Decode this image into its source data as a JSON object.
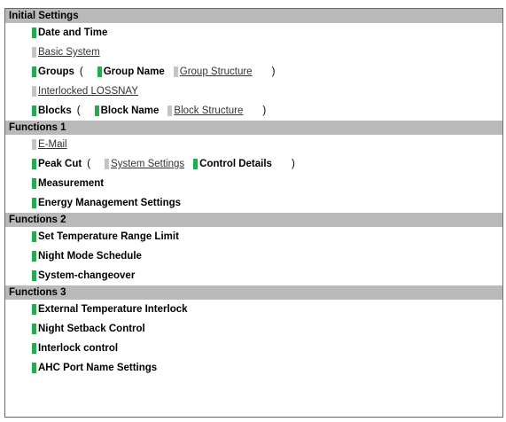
{
  "sections": [
    {
      "title": "Initial Settings",
      "rows": [
        {
          "items": [
            {
              "label": "Date and Time",
              "active": true
            }
          ]
        },
        {
          "items": [
            {
              "label": "Basic System",
              "active": false
            }
          ]
        },
        {
          "items": [
            {
              "label": "Groups",
              "active": true,
              "paren": "open"
            },
            {
              "label": "Group Name",
              "active": true
            },
            {
              "label": "Group Structure",
              "active": false,
              "paren": "close"
            }
          ]
        },
        {
          "items": [
            {
              "label": "Interlocked LOSSNAY",
              "active": false
            }
          ]
        },
        {
          "items": [
            {
              "label": "Blocks",
              "active": true,
              "paren": "open"
            },
            {
              "label": "Block Name",
              "active": true
            },
            {
              "label": "Block Structure",
              "active": false,
              "paren": "close"
            }
          ]
        }
      ]
    },
    {
      "title": "Functions 1",
      "rows": [
        {
          "items": [
            {
              "label": "E-Mail",
              "active": false
            }
          ]
        },
        {
          "items": [
            {
              "label": "Peak Cut",
              "active": true,
              "paren": "open"
            },
            {
              "label": "System Settings",
              "active": false
            },
            {
              "label": "Control Details",
              "active": true,
              "paren": "close"
            }
          ]
        },
        {
          "items": [
            {
              "label": "Measurement",
              "active": true
            }
          ]
        },
        {
          "items": [
            {
              "label": "Energy Management Settings",
              "active": true
            }
          ]
        }
      ]
    },
    {
      "title": "Functions 2",
      "rows": [
        {
          "items": [
            {
              "label": "Set Temperature Range Limit",
              "active": true
            }
          ]
        },
        {
          "items": [
            {
              "label": "Night Mode Schedule",
              "active": true
            }
          ]
        },
        {
          "items": [
            {
              "label": "System-changeover",
              "active": true
            }
          ]
        }
      ]
    },
    {
      "title": "Functions 3",
      "rows": [
        {
          "items": [
            {
              "label": "External Temperature Interlock",
              "active": true
            }
          ]
        },
        {
          "items": [
            {
              "label": "Night Setback Control",
              "active": true
            }
          ]
        },
        {
          "items": [
            {
              "label": "Interlock control",
              "active": true
            }
          ]
        },
        {
          "items": [
            {
              "label": "AHC Port Name Settings",
              "active": true
            }
          ]
        }
      ]
    }
  ],
  "symbols": {
    "open_paren": "(",
    "close_paren": ")"
  },
  "colors": {
    "active_marker": "#28a94f",
    "inactive_marker": "#c4c4c4",
    "header_bg": "#b9b9b9"
  }
}
